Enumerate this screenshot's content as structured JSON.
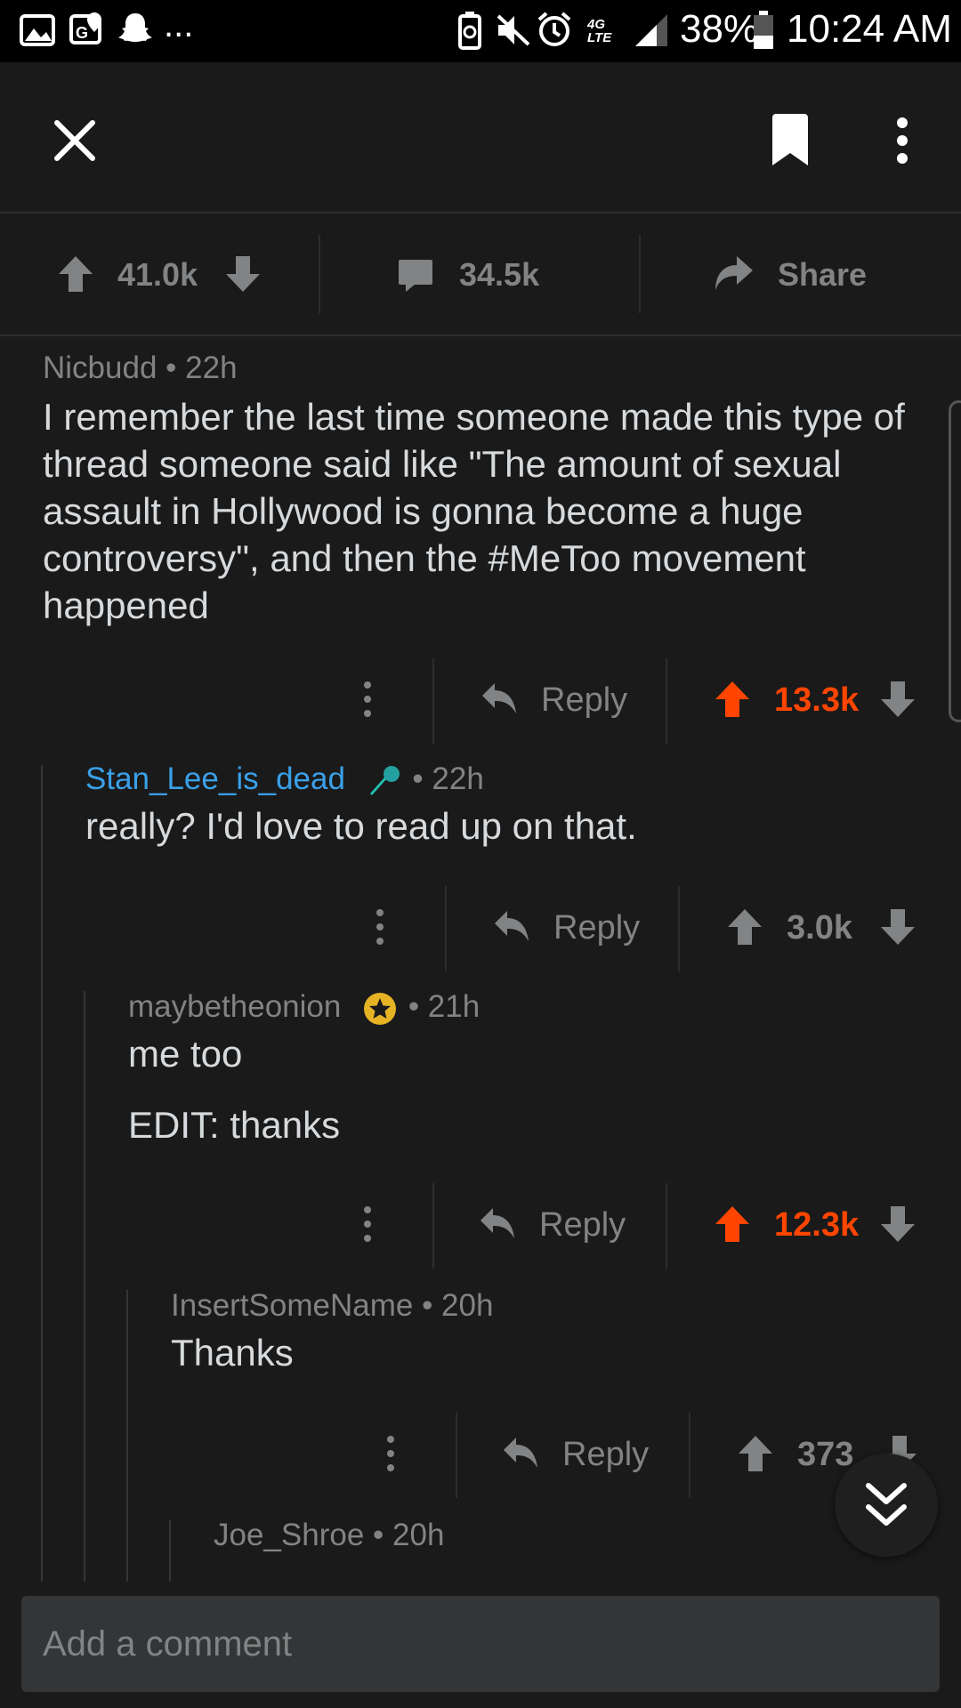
{
  "status_bar": {
    "more": "...",
    "network": "4G LTE",
    "battery": "38%",
    "time": "10:24 AM"
  },
  "header": {
    "close_icon": "close-icon",
    "bookmark_icon": "bookmark-icon",
    "more_icon": "more-vertical-icon"
  },
  "post_actions": {
    "score": "41.0k",
    "comments": "34.5k",
    "share": "Share"
  },
  "comments": [
    {
      "user": "Nicbudd",
      "time": "• 22h",
      "body": "I remember the last time someone made this type of thread someone said like \"The amount of sexual assault in Hollywood is gonna become a huge controversy\", and then the #MeToo movement happened",
      "reply": "Reply",
      "score": "13.3k",
      "upvoted": true
    },
    {
      "user": "Stan_Lee_is_dead",
      "time": "• 22h",
      "body": "really? I'd love to read up on that.",
      "reply": "Reply",
      "score": "3.0k",
      "upvoted": false
    },
    {
      "user": "maybetheonion",
      "time": "• 21h",
      "body": "me too",
      "edit": "EDIT: thanks",
      "reply": "Reply",
      "score": "12.3k",
      "upvoted": true
    },
    {
      "user": "InsertSomeName",
      "time": "• 20h",
      "body": "Thanks",
      "reply": "Reply",
      "score": "373",
      "upvoted": false
    },
    {
      "user": "Joe_Shroe",
      "time": "• 20h"
    }
  ],
  "comment_input": {
    "placeholder": "Add a comment"
  },
  "colors": {
    "background": "#1a1a1b",
    "upvote": "#ff4500",
    "username_blue": "#3aa0e8",
    "muted": "#818384"
  }
}
